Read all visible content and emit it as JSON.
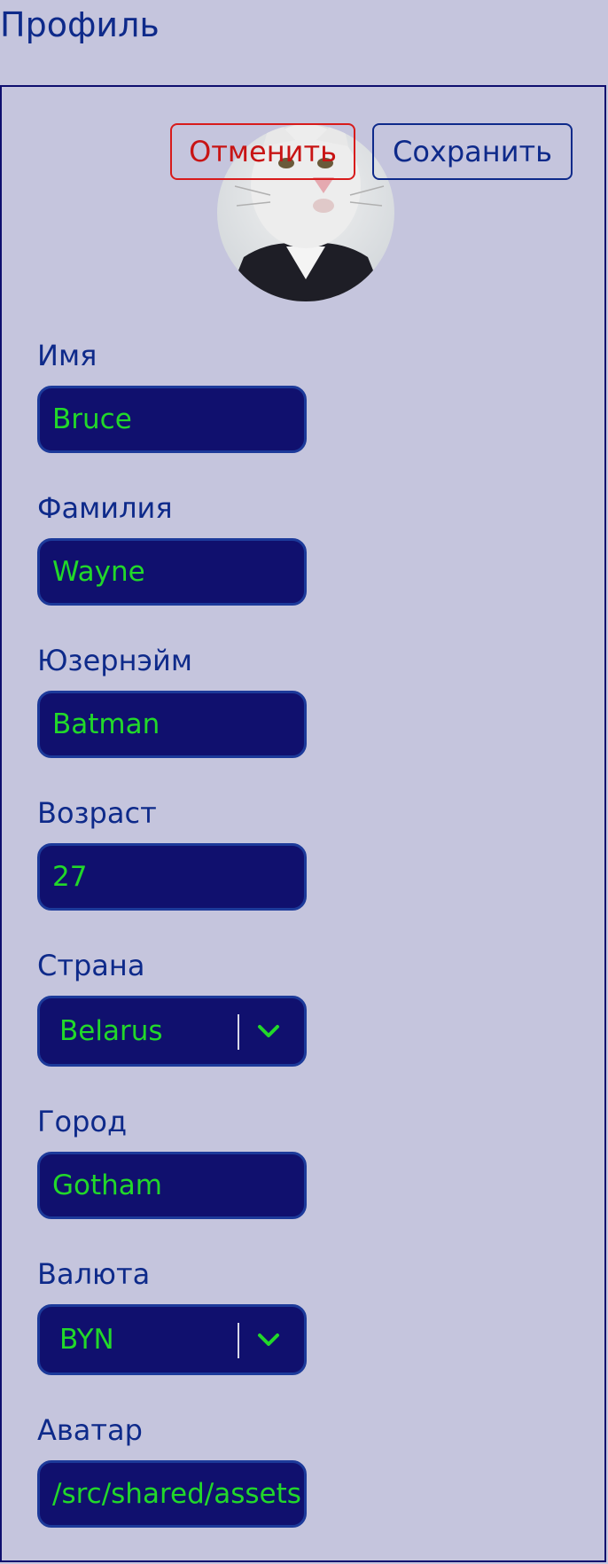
{
  "page": {
    "title": "Профиль"
  },
  "actions": {
    "cancel_label": "Отменить",
    "save_label": "Сохранить"
  },
  "avatar": {
    "alt": "Аватар пользователя"
  },
  "fields": {
    "first_name": {
      "label": "Имя",
      "value": "Bruce"
    },
    "last_name": {
      "label": "Фамилия",
      "value": "Wayne"
    },
    "username": {
      "label": "Юзернэйм",
      "value": "Batman"
    },
    "age": {
      "label": "Возраст",
      "value": "27"
    },
    "country": {
      "label": "Страна",
      "value": "Belarus"
    },
    "city": {
      "label": "Город",
      "value": "Gotham"
    },
    "currency": {
      "label": "Валюта",
      "value": "BYN"
    },
    "avatar_path": {
      "label": "Аватар",
      "value": "/src/shared/assets"
    }
  },
  "colors": {
    "background": "#c5c5dd",
    "primary": "#0e2a8a",
    "input_bg": "#10106e",
    "input_text": "#22d82a",
    "danger": "#c81414"
  },
  "icons": {
    "select_chevron": "chevron-down-icon"
  }
}
